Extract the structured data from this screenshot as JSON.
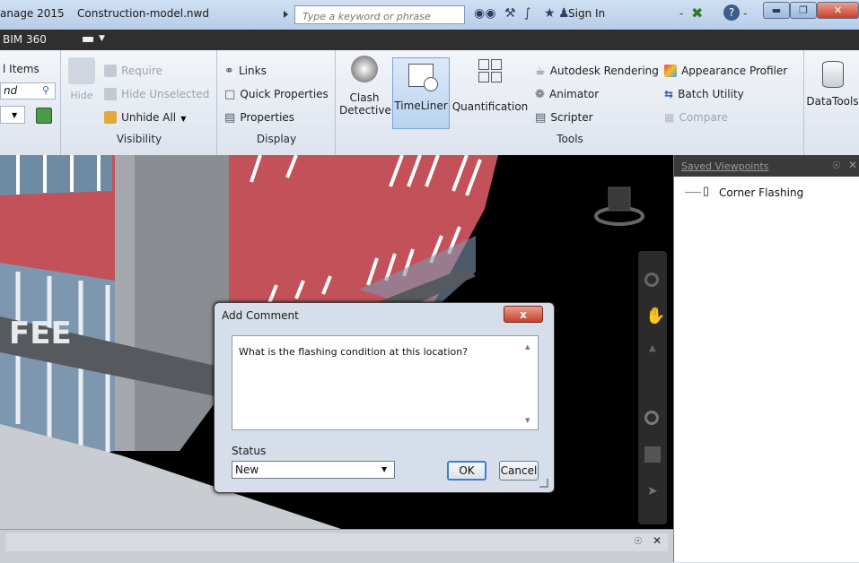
{
  "titlebar": {
    "app_title": "anage 2015",
    "file_name": "Construction-model.nwd",
    "search_placeholder": "Type a keyword or phrase",
    "sign_in": "Sign In",
    "help_dropdown": "-"
  },
  "bimbar": {
    "label": "BIM 360"
  },
  "ribbon": {
    "select_group": {
      "items_label": "l Items",
      "field_text": "nd"
    },
    "visibility": {
      "label": "Visibility",
      "hide": "Hide",
      "require": "Require",
      "hide_unselected": "Hide Unselected",
      "unhide_all": "Unhide All"
    },
    "display": {
      "label": "Display",
      "links": "Links",
      "quick_properties": "Quick Properties",
      "properties": "Properties"
    },
    "tools": {
      "label": "Tools",
      "clash_detective_1": "Clash",
      "clash_detective_2": "Detective",
      "timeliner": "TimeLiner",
      "quantification": "Quantification",
      "autodesk_rendering": "Autodesk Rendering",
      "animator": "Animator",
      "scripter": "Scripter",
      "appearance_profiler": "Appearance Profiler",
      "batch_utility": "Batch Utility",
      "compare": "Compare"
    },
    "datatools": "DataTools"
  },
  "viewport": {
    "sign_letters": "FEE"
  },
  "saved_viewpoints": {
    "title": "Saved Viewpoints",
    "items": [
      {
        "label": "Corner Flashing"
      }
    ]
  },
  "dialog": {
    "title": "Add Comment",
    "close_label": "x",
    "comment_text": "What is the flashing condition at this location?",
    "status_label": "Status",
    "status_value": "New",
    "ok_label": "OK",
    "cancel_label": "Cancel"
  },
  "colors": {
    "accent": "#b7cde8",
    "close_red": "#c8412a",
    "building_red": "#c25159",
    "viewport_bg": "#000000"
  }
}
